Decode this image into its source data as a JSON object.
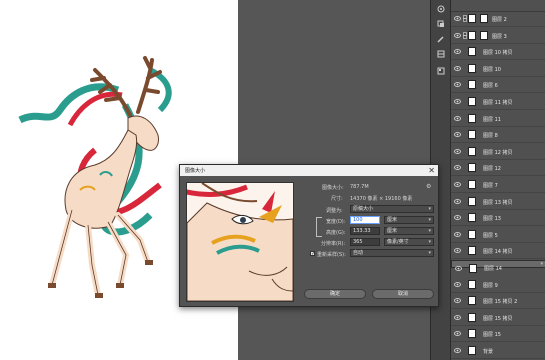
{
  "dialog": {
    "title": "图像大小",
    "close_glyph": "✕",
    "image_size_label": "图像大小:",
    "image_size_value": "787.7M",
    "dimensions_label": "尺寸:",
    "dimensions_value": "14370 像素 × 19160 像素",
    "fit_label": "调整为:",
    "fit_value": "原稿大小",
    "width_label": "宽度(D):",
    "width_value": "100",
    "width_unit": "厘米",
    "height_label": "高度(G):",
    "height_value": "133.33",
    "height_unit": "厘米",
    "resolution_label": "分辨率(R):",
    "resolution_value": "365",
    "resolution_unit": "像素/英寸",
    "resample_label": "重新采样(S):",
    "resample_checked": true,
    "resample_value": "自动",
    "ok_label": "确定",
    "cancel_label": "取消"
  },
  "layers": [
    {
      "name": "图层 2",
      "has_mask": true
    },
    {
      "name": "图层 3",
      "has_mask": true
    },
    {
      "name": "图层 10 拷贝",
      "has_mask": false
    },
    {
      "name": "图层 10",
      "has_mask": false
    },
    {
      "name": "图层 6",
      "has_mask": false
    },
    {
      "name": "图层 11 拷贝",
      "has_mask": false
    },
    {
      "name": "图层 11",
      "has_mask": false
    },
    {
      "name": "图层 8",
      "has_mask": false
    },
    {
      "name": "图层 12 拷贝",
      "has_mask": false
    },
    {
      "name": "图层 12",
      "has_mask": false
    },
    {
      "name": "图层 7",
      "has_mask": false
    },
    {
      "name": "图层 13 拷贝",
      "has_mask": false
    },
    {
      "name": "图层 13",
      "has_mask": false
    },
    {
      "name": "图层 5",
      "has_mask": false
    },
    {
      "name": "图层 14 拷贝",
      "has_mask": false
    },
    {
      "name": "图层 14",
      "has_mask": false,
      "selected": true
    },
    {
      "name": "图层 9",
      "has_mask": false
    },
    {
      "name": "图层 15 拷贝 2",
      "has_mask": false
    },
    {
      "name": "图层 15 拷贝",
      "has_mask": false
    },
    {
      "name": "图层 15",
      "has_mask": false
    },
    {
      "name": "背景",
      "has_mask": false
    }
  ],
  "colors": {
    "accent_teal": "#2a9d8f",
    "accent_red": "#d8263a",
    "antler_brown": "#7a4a2e",
    "fur_peach": "#f6dcc6"
  },
  "icons": [
    "eye-icon",
    "chain-link-icon",
    "gear-icon",
    "close-icon",
    "ai-icon",
    "clone-icon",
    "brush-icon",
    "palette-icon",
    "adjust-icon"
  ]
}
